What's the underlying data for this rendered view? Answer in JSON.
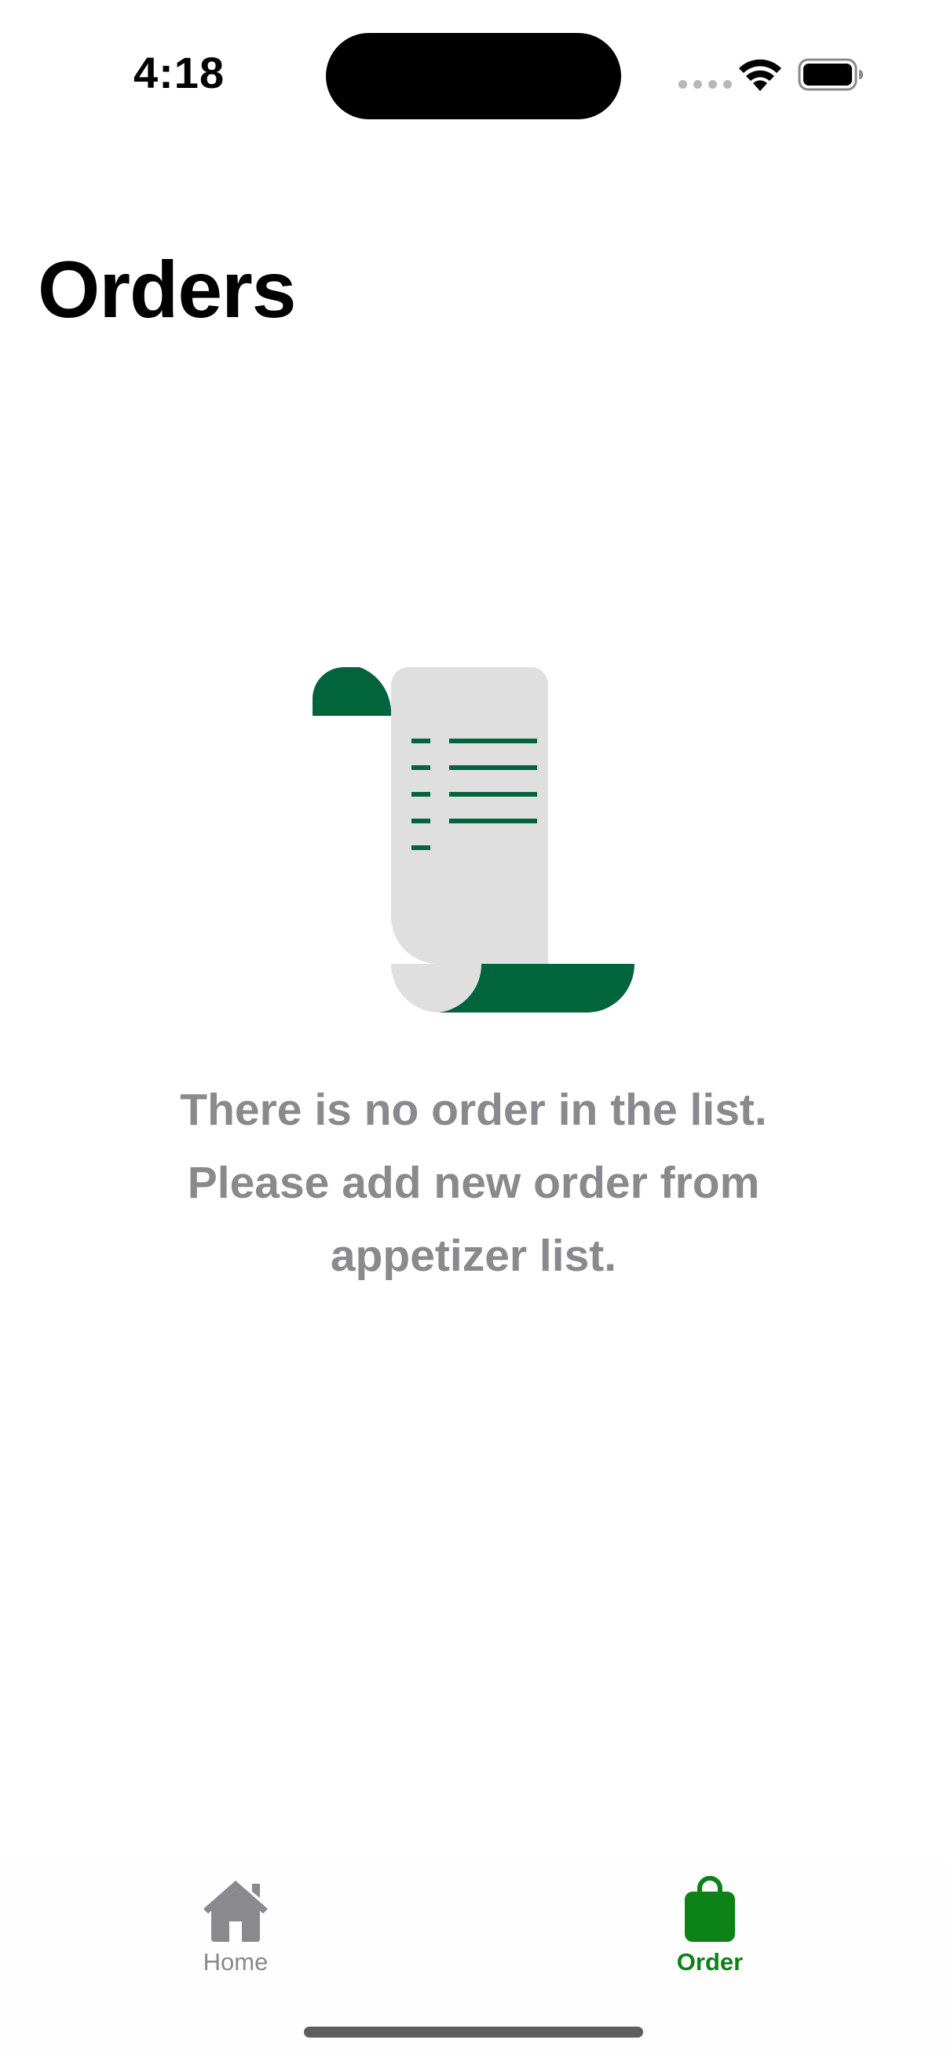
{
  "status_bar": {
    "time": "4:18"
  },
  "header": {
    "title": "Orders"
  },
  "empty_state": {
    "illustration": "receipt-scroll-icon",
    "message_lines": [
      "There is no order in the list.",
      "Please add new order from",
      "appetizer list."
    ]
  },
  "tab_bar": {
    "tabs": [
      {
        "label": "Home",
        "icon": "house-icon",
        "selected": false
      },
      {
        "label": "Order",
        "icon": "shopping-bag-icon",
        "selected": true
      }
    ]
  },
  "colors": {
    "accent": "#0c8116",
    "receipt_green": "#02643c",
    "receipt_paper": "#dfdfdf",
    "inactive": "#8a8a8e"
  }
}
